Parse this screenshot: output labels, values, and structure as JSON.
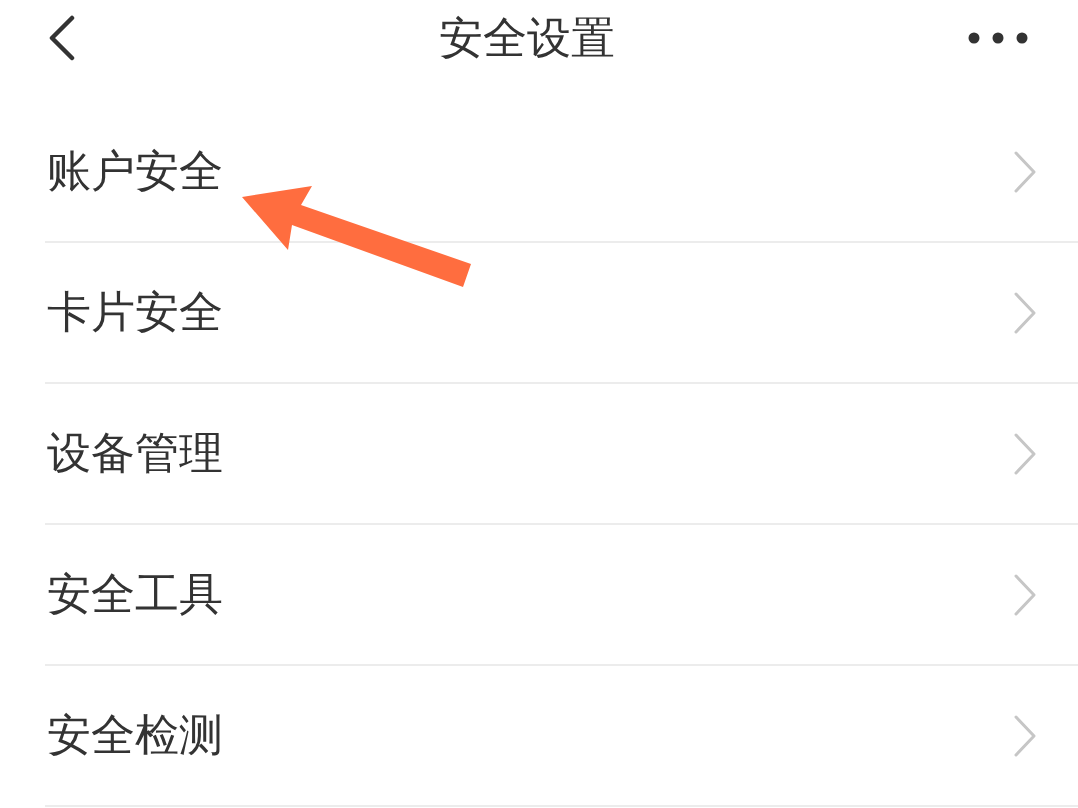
{
  "header": {
    "title": "安全设置"
  },
  "menu_items": [
    {
      "label": "账户安全"
    },
    {
      "label": "卡片安全"
    },
    {
      "label": "设备管理"
    },
    {
      "label": "安全工具"
    },
    {
      "label": "安全检测"
    }
  ]
}
